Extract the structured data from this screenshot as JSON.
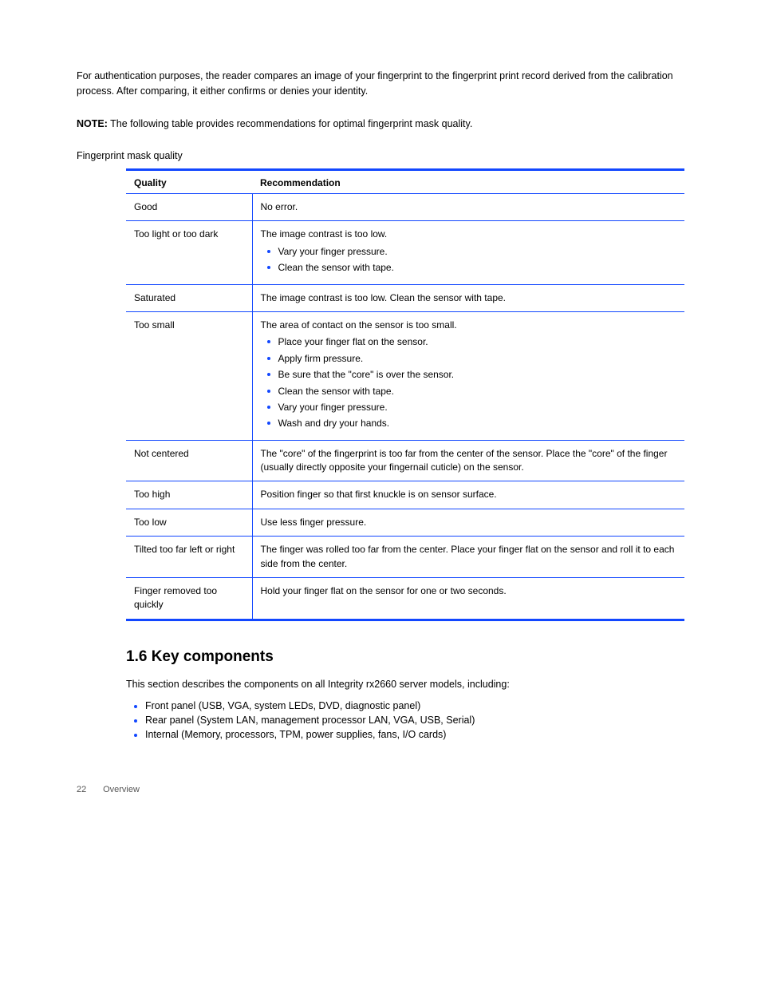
{
  "lead": "For authentication purposes, the reader compares an image of your fingerprint to the fingerprint print record derived from the calibration process. After comparing, it either confirms or denies your identity.",
  "note_label": "NOTE:",
  "note_body": "The following table provides recommendations for optimal fingerprint mask quality.",
  "mask_line": "Fingerprint mask quality",
  "table": {
    "headers": [
      "Quality",
      "Recommendation"
    ],
    "rows": [
      {
        "q": "Good",
        "r": "No error."
      },
      {
        "q": "Too light or too dark",
        "r": "The image contrast is too low.",
        "list": [
          "Vary your finger pressure.",
          "Clean the sensor with tape."
        ]
      },
      {
        "q": "Saturated",
        "r": "The image contrast is too low. Clean the sensor with tape."
      },
      {
        "q": "Too small",
        "r": "The area of contact on the sensor is too small.",
        "list": [
          "Place your finger flat on the sensor.",
          "Apply firm pressure.",
          "Be sure that the \"core\" is over the sensor.",
          "Clean the sensor with tape.",
          "Vary your finger pressure.",
          "Wash and dry your hands."
        ]
      },
      {
        "q": "Not centered",
        "r": "The \"core\" of the fingerprint is too far from the center of the sensor. Place the \"core\" of the finger (usually directly opposite your fingernail cuticle) on the sensor."
      },
      {
        "q": "Too high",
        "r": "Position finger so that first knuckle is on sensor surface."
      },
      {
        "q": "Too low",
        "r": "Use less finger pressure."
      },
      {
        "q": "Tilted too far left or right",
        "r": "The finger was rolled too far from the center. Place your finger flat on the sensor and roll it to each side from the center."
      },
      {
        "q": "Finger removed too quickly",
        "r": "Hold your finger flat on the sensor for one or two seconds."
      }
    ]
  },
  "section_num": "1.6",
  "section_title": "Key components",
  "section_intro": "This section describes the components on all Integrity rx2660 server models, including:",
  "components": [
    "Front panel (USB, VGA, system LEDs, DVD, diagnostic panel)",
    "Rear panel (System LAN, management processor LAN, VGA, USB, Serial)",
    "Internal (Memory, processors, TPM, power supplies, fans, I/O cards)"
  ],
  "footer_page": "22",
  "footer_text": "Overview"
}
